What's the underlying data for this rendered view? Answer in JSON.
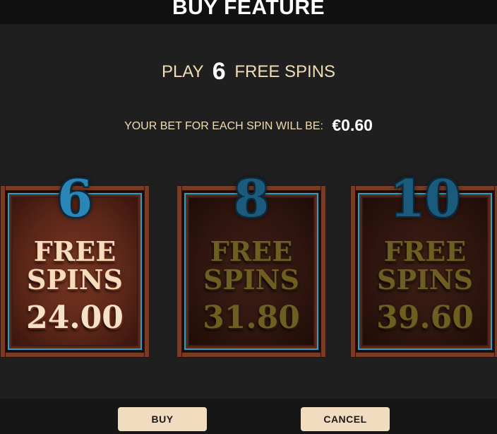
{
  "dialog": {
    "title": "BUY FEATURE",
    "play_prefix": "PLAY",
    "play_count": "6",
    "play_suffix": "FREE SPINS",
    "bet_label": "YOUR BET FOR EACH SPIN WILL BE:",
    "bet_amount": "€0.60"
  },
  "options": [
    {
      "spins": "6",
      "line1": "FREE",
      "line2": "SPINS",
      "price": "24.00",
      "selected": true
    },
    {
      "spins": "8",
      "line1": "FREE",
      "line2": "SPINS",
      "price": "31.80",
      "selected": false
    },
    {
      "spins": "10",
      "line1": "FREE",
      "line2": "SPINS",
      "price": "39.60",
      "selected": false
    }
  ],
  "buttons": {
    "buy": "BUY",
    "cancel": "CANCEL"
  },
  "colors": {
    "background": "#1f1f1f",
    "accent_text": "#f1dcb4",
    "button_bg": "#f2dcc0",
    "number_blue": "#2b86b8"
  }
}
